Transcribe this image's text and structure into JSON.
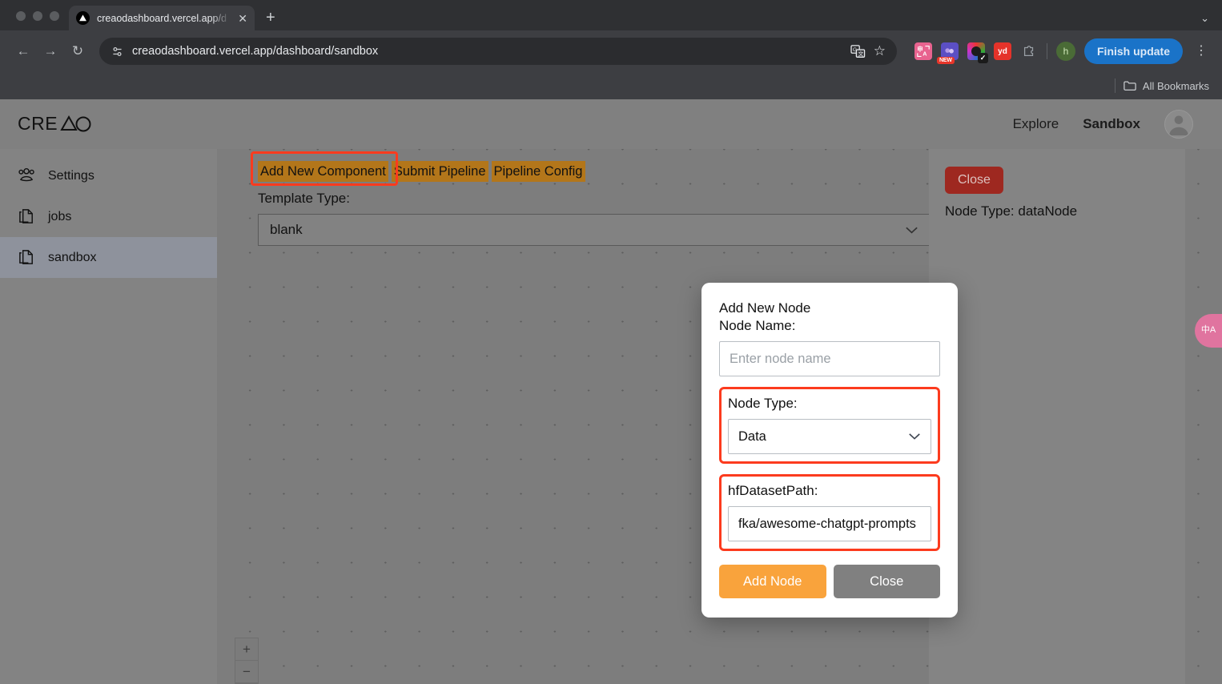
{
  "browser": {
    "tab": {
      "favicon": "vercel-logo-icon",
      "title": "creaodashboard.vercel.app/d",
      "close": "✕"
    },
    "new_tab": "+",
    "window_chevron": "⌄",
    "nav": {
      "back": "←",
      "forward": "→",
      "reload": "↻"
    },
    "omnibox": {
      "site_info_icon": "site-settings-icon",
      "url": "creaodashboard.vercel.app/dashboard/sandbox",
      "translate_icon": "translate-icon",
      "bookmark_icon": "☆"
    },
    "extensions": [
      {
        "name": "translate-extension-icon",
        "label": "申A"
      },
      {
        "name": "new-extension-icon",
        "label": "",
        "badge": "NEW"
      },
      {
        "name": "color-ring-extension-icon",
        "label": "",
        "check": "✓"
      },
      {
        "name": "youdao-extension-icon",
        "label": "yd"
      },
      {
        "name": "extensions-puzzle-icon",
        "label": ""
      }
    ],
    "profile_initial": "h",
    "finish_update": "Finish update",
    "menu_kebab": "⋮",
    "bookmarks": {
      "folder_icon": "folder-icon",
      "label": "All Bookmarks"
    }
  },
  "app": {
    "logo": "CREAO",
    "nav": [
      {
        "label": "Explore",
        "active": false
      },
      {
        "label": "Sandbox",
        "active": true
      }
    ],
    "avatar": "user-avatar"
  },
  "sidebar": {
    "items": [
      {
        "label": "Settings",
        "icon": "users-group-icon",
        "active": false
      },
      {
        "label": "jobs",
        "icon": "documents-copy-icon",
        "active": false
      },
      {
        "label": "sandbox",
        "icon": "documents-copy-icon",
        "active": true
      }
    ]
  },
  "canvas": {
    "toolbar": [
      {
        "label": "Add New Component",
        "highlighted": true
      },
      {
        "label": "Submit Pipeline",
        "highlighted": false
      },
      {
        "label": "Pipeline Config",
        "highlighted": false
      }
    ],
    "template_label": "Template Type:",
    "template_value": "blank",
    "zoom_in": "+",
    "zoom_out": "−"
  },
  "right_panel": {
    "close_label": "Close",
    "node_type_text": "Node Type: dataNode"
  },
  "float_widget": {
    "label": "中A",
    "name": "translate-floating-widget"
  },
  "modal": {
    "title": "Add New Node",
    "node_name_label": "Node Name:",
    "node_name_value": "",
    "node_name_placeholder": "Enter node name",
    "node_type_label": "Node Type:",
    "node_type_value": "Data",
    "hf_dataset_label": "hfDatasetPath:",
    "hf_dataset_value": "fka/awesome-chatgpt-prompts",
    "add_button": "Add Node",
    "close_button": "Close"
  },
  "colors": {
    "highlight_red": "#fc3b1e",
    "toolbar_amber": "#b3761a",
    "primary_orange": "#f9a33c",
    "panel_close_red": "#9e2820",
    "browser_blue": "#1a73c8"
  }
}
